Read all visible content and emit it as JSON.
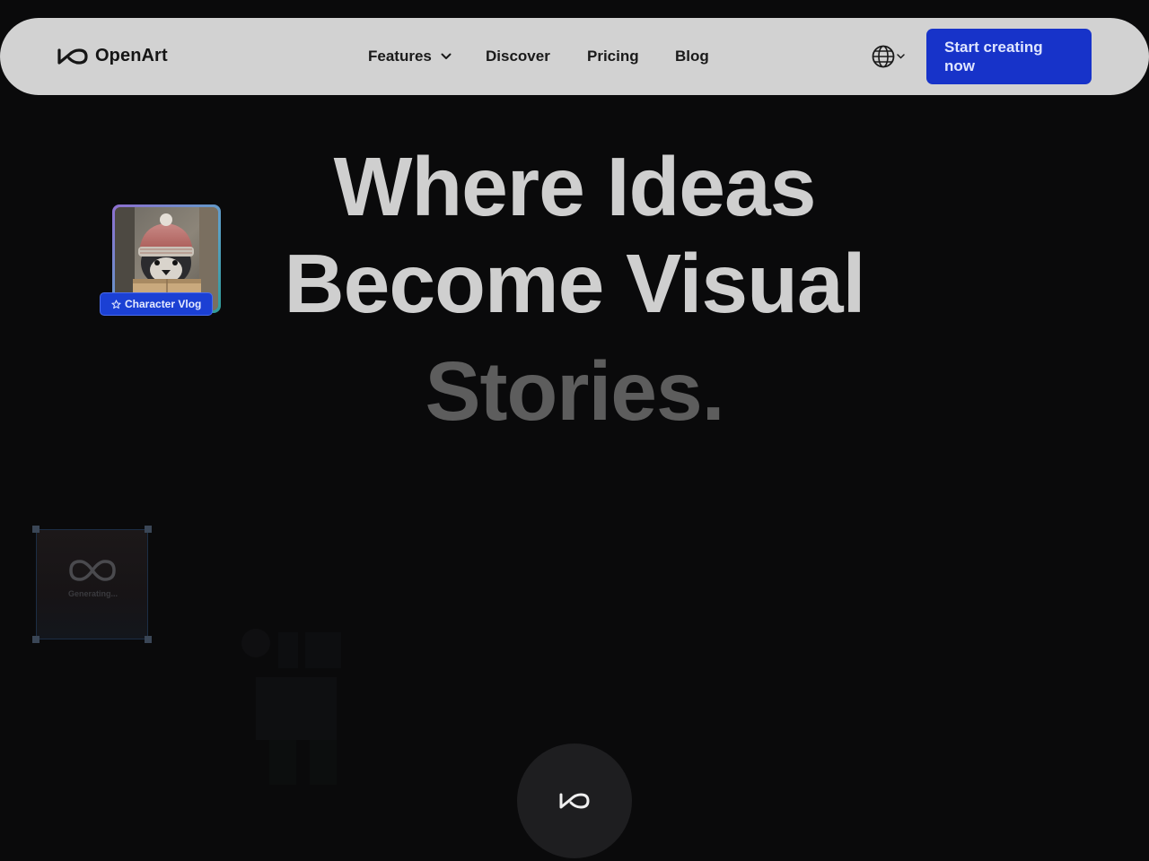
{
  "nav": {
    "logo_text": "OpenArt",
    "links": [
      {
        "label": "Features"
      },
      {
        "label": "Discover"
      },
      {
        "label": "Pricing"
      },
      {
        "label": "Blog"
      }
    ],
    "language_icon": "globe-icon",
    "cta_label": "Start creating now"
  },
  "hero": {
    "line1": "Where Ideas",
    "line2": "Become Visual",
    "line3": "Stories."
  },
  "cards": {
    "vlog_badge": "Character Vlog",
    "vlog_icon": "star-icon",
    "generating_text": "Generating..."
  },
  "fab": {
    "icon": "infinity-logo-icon"
  },
  "colors": {
    "nav_bg": "#d2d2d2",
    "cta_bg": "#1733c9",
    "page_bg": "#0a0a0b",
    "hero_text": "#cfcfcf",
    "hero_dim": "#5d5d5d"
  }
}
